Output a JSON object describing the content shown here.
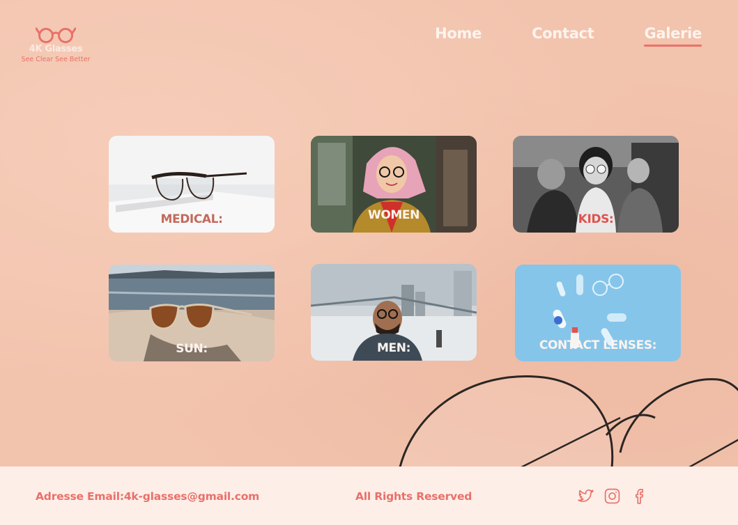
{
  "brand": {
    "name": "4K Glasses",
    "tagline": "See Clear See Better",
    "accent_color": "#e9706a",
    "background_color": "#f2c3ad"
  },
  "nav": {
    "items": [
      {
        "label": "Home",
        "active": false
      },
      {
        "label": "Contact",
        "active": false
      },
      {
        "label": "Galerie",
        "active": true
      }
    ]
  },
  "gallery": {
    "cards": [
      {
        "label": "MEDICAL:",
        "icon": "medical-glasses-photo"
      },
      {
        "label": "WOMEN",
        "icon": "woman-photo"
      },
      {
        "label": "KIDS:",
        "icon": "kid-photo"
      },
      {
        "label": "SUN:",
        "icon": "sunglasses-photo"
      },
      {
        "label": "MEN:",
        "icon": "man-photo"
      },
      {
        "label": "CONTACT LENSES:",
        "icon": "contact-lenses-photo"
      }
    ]
  },
  "footer": {
    "email": "Adresse Email:4k-glasses@gmail.com",
    "rights": "All Rights Reserved",
    "social": [
      "twitter-icon",
      "instagram-icon",
      "facebook-icon"
    ]
  }
}
